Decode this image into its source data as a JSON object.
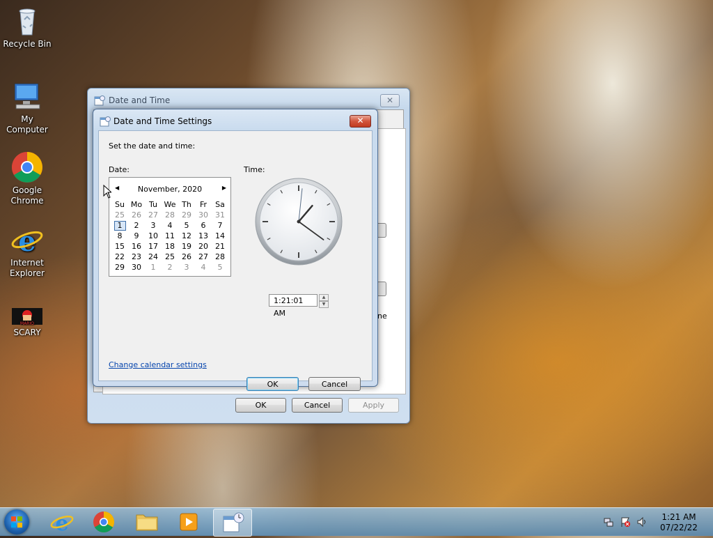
{
  "desktop": {
    "icons": [
      {
        "label": "Recycle Bin",
        "icon": "recycle-bin-icon"
      },
      {
        "label": "My Computer",
        "icon": "computer-icon"
      },
      {
        "label": "Google Chrome",
        "icon": "chrome-icon"
      },
      {
        "label": "Internet Explorer",
        "icon": "internet-explorer-icon"
      },
      {
        "label": "SCARY",
        "icon": "game-icon"
      }
    ]
  },
  "outer_window": {
    "title": "Date and Time",
    "close_symbol": "✕",
    "ghost_text": "ne",
    "buttons": {
      "ok": "OK",
      "cancel": "Cancel",
      "apply": "Apply"
    }
  },
  "dialog": {
    "title": "Date and Time Settings",
    "close_symbol": "✕",
    "instruction": "Set the date and time:",
    "date_label": "Date:",
    "time_label": "Time:",
    "calendar": {
      "month_year": "November, 2020",
      "weekdays": [
        "Su",
        "Mo",
        "Tu",
        "We",
        "Th",
        "Fr",
        "Sa"
      ],
      "weeks": [
        [
          "25",
          "26",
          "27",
          "28",
          "29",
          "30",
          "31"
        ],
        [
          "1",
          "2",
          "3",
          "4",
          "5",
          "6",
          "7"
        ],
        [
          "8",
          "9",
          "10",
          "11",
          "12",
          "13",
          "14"
        ],
        [
          "15",
          "16",
          "17",
          "18",
          "19",
          "20",
          "21"
        ],
        [
          "22",
          "23",
          "24",
          "25",
          "26",
          "27",
          "28"
        ],
        [
          "29",
          "30",
          "1",
          "2",
          "3",
          "4",
          "5"
        ]
      ],
      "selected_day": "1"
    },
    "clock": {
      "hour": 1,
      "minute": 21,
      "second": 1
    },
    "time_value": "1:21:01 AM",
    "change_calendar_link": "Change calendar settings",
    "ok_label": "OK",
    "cancel_label": "Cancel"
  },
  "taskbar": {
    "apps": [
      "internet-explorer-icon",
      "chrome-icon",
      "folder-icon",
      "media-player-icon",
      "date-time-settings-icon"
    ],
    "clock_time": "1:21 AM",
    "clock_date": "07/22/22"
  }
}
